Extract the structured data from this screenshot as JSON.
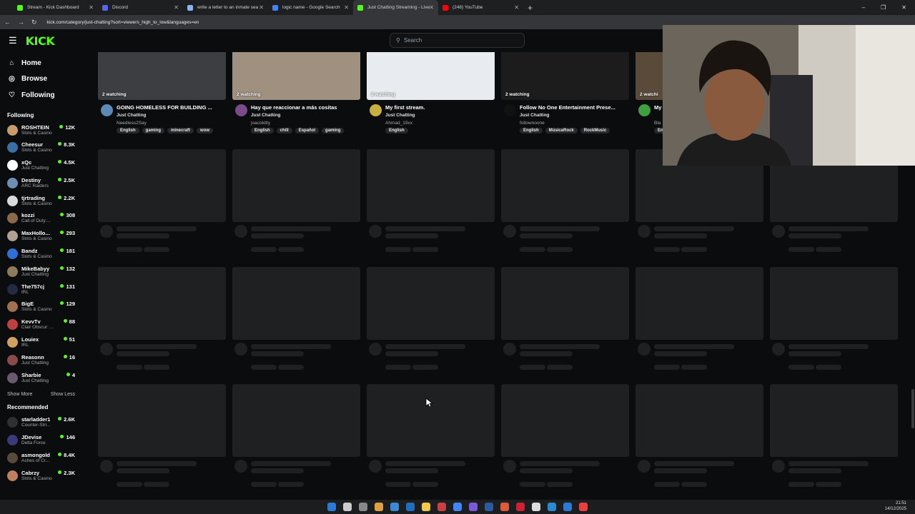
{
  "browser": {
    "tabs": [
      {
        "label": "Stream - Kick Dashboard",
        "color": "#53fc18"
      },
      {
        "label": "Discord",
        "color": "#5865f2"
      },
      {
        "label": "write a letter to an inmate sea",
        "color": "#8ab4f8"
      },
      {
        "label": "logic name - Google Search",
        "color": "#4285f4"
      },
      {
        "label": "Just Chatting Streaming - Live",
        "color": "#53fc18",
        "active": true
      },
      {
        "label": "(248) YouTube",
        "color": "#ff0000"
      }
    ],
    "url": "kick.com/category/just-chatting?sort=viewers_high_to_low&languages=en"
  },
  "header": {
    "logo": "KICK",
    "search_placeholder": "Search"
  },
  "sidebar": {
    "nav": [
      {
        "label": "Home",
        "icon": "home-icon"
      },
      {
        "label": "Browse",
        "icon": "compass-icon"
      },
      {
        "label": "Following",
        "icon": "heart-icon"
      }
    ],
    "following_heading": "Following",
    "following": [
      {
        "name": "ROSHTEIN",
        "category": "Slots & Casino",
        "viewers": "12K",
        "color": "#c89b6d"
      },
      {
        "name": "Cheesur",
        "category": "Slots & Casino",
        "viewers": "8.3K",
        "color": "#3a6ea5"
      },
      {
        "name": "xQc",
        "category": "Just Chatting",
        "viewers": "4.5K",
        "color": "#ffffff"
      },
      {
        "name": "Destiny",
        "category": "ARC Raiders",
        "viewers": "2.5K",
        "color": "#6d8fb5"
      },
      {
        "name": "tjrtrading",
        "category": "Slots & Casino",
        "viewers": "2.2K",
        "color": "#d9d9d9"
      },
      {
        "name": "kozzi",
        "category": "Call of Duty:...",
        "viewers": "308",
        "color": "#8a6a4a"
      },
      {
        "name": "MaxHollo...",
        "category": "Slots & Casino",
        "viewers": "293",
        "color": "#b0a090"
      },
      {
        "name": "Bandz",
        "category": "Slots & Casino",
        "viewers": "181",
        "color": "#2f6fd6"
      },
      {
        "name": "MikeBabyy",
        "category": "Just Chatting",
        "viewers": "132",
        "color": "#8c7a5a"
      },
      {
        "name": "The757cj",
        "category": "IRL",
        "viewers": "131",
        "color": "#222a44"
      },
      {
        "name": "BigE",
        "category": "Slots & Casino",
        "viewers": "129",
        "color": "#a07050"
      },
      {
        "name": "KevvTv",
        "category": "Clair Obscur: ...",
        "viewers": "88",
        "color": "#c04040"
      },
      {
        "name": "Louiex",
        "category": "IRL",
        "viewers": "51",
        "color": "#d0a060"
      },
      {
        "name": "Reasonn",
        "category": "Just Chatting",
        "viewers": "16",
        "color": "#8a4a4a"
      },
      {
        "name": "Sharbie",
        "category": "Just Chatting",
        "viewers": "4",
        "color": "#6a5a70"
      }
    ],
    "show_more": "Show More",
    "show_less": "Show Less",
    "recommended_heading": "Recommended",
    "recommended": [
      {
        "name": "starladder1",
        "category": "Counter-Stri...",
        "viewers": "2.6K",
        "color": "#303030"
      },
      {
        "name": "JDevise",
        "category": "Delta Force",
        "viewers": "146",
        "color": "#3a3a7a"
      },
      {
        "name": "asmongold",
        "category": "Ashes of Cr...",
        "viewers": "8.4K",
        "color": "#5a4a3a"
      },
      {
        "name": "Cabrzy",
        "category": "Slots & Casino",
        "viewers": "2.3K",
        "color": "#c08060"
      }
    ]
  },
  "streams": [
    {
      "watching": "2 watching",
      "title": "GOING HOMELESS FOR BUILDING ...",
      "category": "Just Chatting",
      "channel": "Needless2Say",
      "tags": [
        "English",
        "gaming",
        "minecraft",
        "wow"
      ],
      "thumb": "#3c3e42",
      "avatar": "#5a8ab5"
    },
    {
      "watching": "2 watching",
      "title": "Hay que reaccionar a más cositas",
      "category": "Just Chatting",
      "channel": "joacokitty",
      "tags": [
        "English",
        "chill",
        "Español",
        "gaming"
      ],
      "thumb": "#a09080",
      "avatar": "#7a4a8a"
    },
    {
      "watching": "2 watching",
      "title": "My first stream.",
      "category": "Just Chatting",
      "channel": "Ahmad_19xx",
      "tags": [
        "English"
      ],
      "thumb": "#e8ecf0",
      "avatar": "#c8b040"
    },
    {
      "watching": "2 watching",
      "title": "Follow No One Entertainment Prese...",
      "category": "Just Chatting",
      "channel": "follownoone",
      "tags": [
        "English",
        "MúsicaRock",
        "RockMusic"
      ],
      "thumb": "#1c1c1c",
      "avatar": "#111111"
    },
    {
      "watching": "2 watchi",
      "title": "My",
      "category": "",
      "channel": "Bla",
      "tags": [
        "En"
      ],
      "thumb": "#5a4a3a",
      "avatar": "#40a040"
    }
  ],
  "taskbar": {
    "time": "21:51",
    "date": "14/12/2025"
  }
}
